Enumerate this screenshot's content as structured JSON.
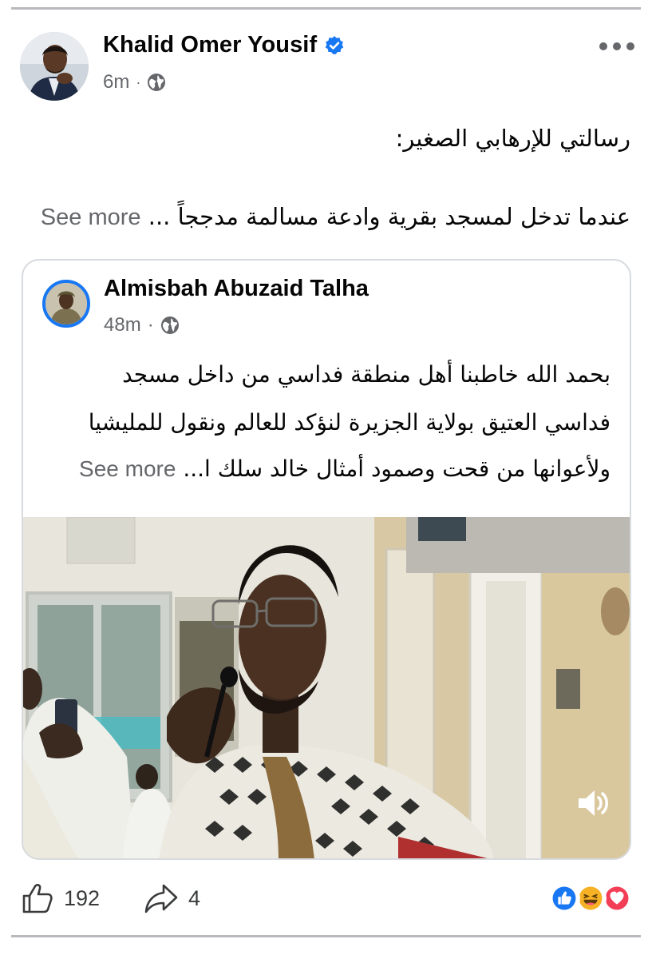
{
  "post": {
    "author": "Khalid Omer Yousif",
    "time": "6m",
    "separator": "·",
    "text_lines": [
      "رسالتي للإرهابي الصغير:",
      "عندما تدخل لمسجد بقرية وادعة مسالمة مدججاً ..."
    ],
    "see_more": "See more"
  },
  "shared": {
    "author": "Almisbah Abuzaid Talha",
    "time": "48m",
    "separator": "·",
    "text_lines": [
      "بحمد الله خاطبنا أهل منطقة فداسي من داخل مسجد",
      "فداسي العتيق بولاية الجزيرة لنؤكد للعالم ونقول للمليشيا",
      "ولأعوانها من قحت وصمود أمثال خالد سلك ا..."
    ],
    "see_more": "See more"
  },
  "footer": {
    "likes": "192",
    "shares": "4"
  },
  "icons": {
    "verified": "verified-badge-icon",
    "privacy": "globe-icon",
    "like": "thumbs-up-icon",
    "share": "share-arrow-icon",
    "sound": "speaker-icon",
    "reactions": [
      "like-reaction-icon",
      "haha-reaction-icon",
      "love-reaction-icon"
    ]
  },
  "colors": {
    "brand_blue": "#1877f2",
    "secondary_text": "#65676b",
    "love": "#f33e58",
    "haha": "#f7b125"
  }
}
